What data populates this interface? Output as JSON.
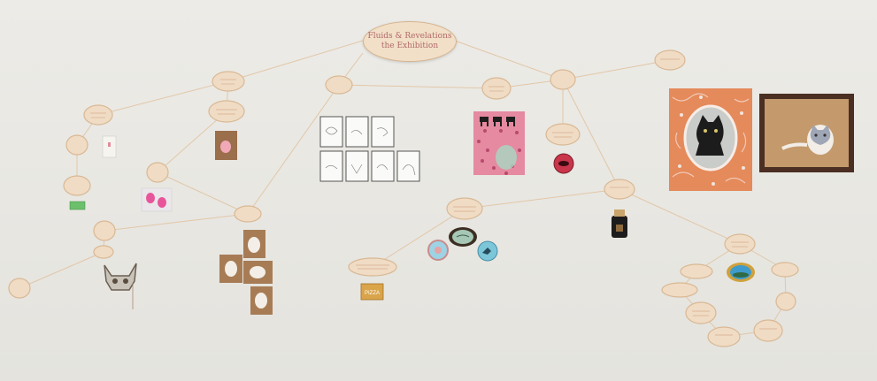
{
  "title_tag": {
    "line1": "Fluids & Revelations",
    "line2": "the Exhibition"
  },
  "colors": {
    "wall": "#e9e8e3",
    "tag": "#f0dcc4",
    "string": "#e2c7a8",
    "orange_painting": "#e58a5a",
    "pink_painting": "#e58aa0"
  },
  "pictures": [
    "black-cat-portrait",
    "framed-cat-drawing",
    "pink-spotted-painting",
    "cat-sketch-cards",
    "kraft-cutout-panels",
    "cat-head-pin"
  ]
}
